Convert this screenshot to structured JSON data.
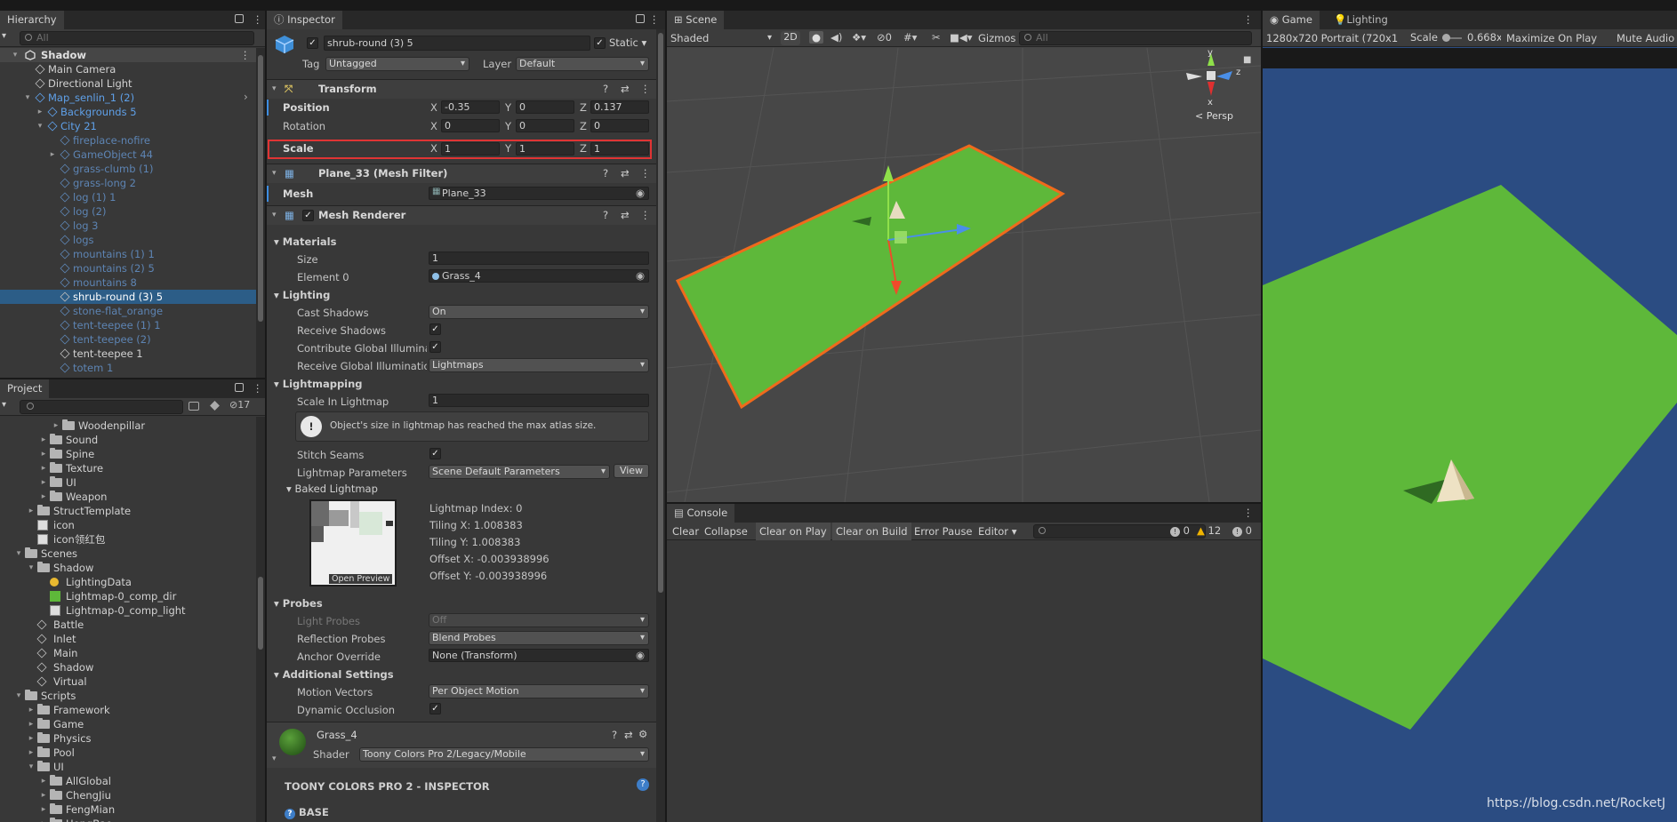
{
  "hierarchy": {
    "tab": "Hierarchy",
    "search_placeholder": "All",
    "scene": "Shadow",
    "items": [
      {
        "label": "Main Camera",
        "indent": 2,
        "style": "normal"
      },
      {
        "label": "Directional Light",
        "indent": 2,
        "style": "normal"
      },
      {
        "label": "Map_senlin_1 (2)",
        "indent": 2,
        "style": "blue",
        "arrow": "▾"
      },
      {
        "label": "Backgrounds 5",
        "indent": 3,
        "style": "blue",
        "arrow": "▸"
      },
      {
        "label": "City 21",
        "indent": 3,
        "style": "blue",
        "arrow": "▾"
      },
      {
        "label": "fireplace-nofire",
        "indent": 4,
        "style": "dim"
      },
      {
        "label": "GameObject 44",
        "indent": 4,
        "style": "dim",
        "arrow": "▸"
      },
      {
        "label": "grass-clumb (1)",
        "indent": 4,
        "style": "dim"
      },
      {
        "label": "grass-long 2",
        "indent": 4,
        "style": "dim"
      },
      {
        "label": "log (1) 1",
        "indent": 4,
        "style": "dim"
      },
      {
        "label": "log (2)",
        "indent": 4,
        "style": "dim"
      },
      {
        "label": "log 3",
        "indent": 4,
        "style": "dim"
      },
      {
        "label": "logs",
        "indent": 4,
        "style": "dim"
      },
      {
        "label": "mountains (1) 1",
        "indent": 4,
        "style": "dim"
      },
      {
        "label": "mountains (2) 5",
        "indent": 4,
        "style": "dim"
      },
      {
        "label": "mountains 8",
        "indent": 4,
        "style": "dim"
      },
      {
        "label": "shrub-round (3) 5",
        "indent": 4,
        "style": "selected"
      },
      {
        "label": "stone-flat_orange",
        "indent": 4,
        "style": "dim"
      },
      {
        "label": "tent-teepee (1) 1",
        "indent": 4,
        "style": "dim"
      },
      {
        "label": "tent-teepee (2)",
        "indent": 4,
        "style": "dim"
      },
      {
        "label": "tent-teepee 1",
        "indent": 4,
        "style": "white"
      },
      {
        "label": "totem 1",
        "indent": 4,
        "style": "dim"
      }
    ]
  },
  "project": {
    "tab": "Project",
    "hidden_count": "17",
    "items": [
      {
        "label": "Woodenpillar",
        "indent": 3,
        "type": "folder",
        "arrow": "▸"
      },
      {
        "label": "Sound",
        "indent": 2,
        "type": "folder",
        "arrow": "▸"
      },
      {
        "label": "Spine",
        "indent": 2,
        "type": "folder",
        "arrow": "▸"
      },
      {
        "label": "Texture",
        "indent": 2,
        "type": "folder",
        "arrow": "▸"
      },
      {
        "label": "UI",
        "indent": 2,
        "type": "folder",
        "arrow": "▸"
      },
      {
        "label": "Weapon",
        "indent": 2,
        "type": "folder",
        "arrow": "▸"
      },
      {
        "label": "StructTemplate",
        "indent": 1,
        "type": "folder",
        "arrow": "▸"
      },
      {
        "label": "icon",
        "indent": 1,
        "type": "image"
      },
      {
        "label": "icon领红包",
        "indent": 1,
        "type": "image"
      },
      {
        "label": "Scenes",
        "indent": 0,
        "type": "folder",
        "arrow": "▾"
      },
      {
        "label": "Shadow",
        "indent": 1,
        "type": "folder",
        "arrow": "▾"
      },
      {
        "label": "LightingData",
        "indent": 2,
        "type": "lighting"
      },
      {
        "label": "Lightmap-0_comp_dir",
        "indent": 2,
        "type": "lightmap"
      },
      {
        "label": "Lightmap-0_comp_light",
        "indent": 2,
        "type": "image"
      },
      {
        "label": "Battle",
        "indent": 1,
        "type": "scene"
      },
      {
        "label": "Inlet",
        "indent": 1,
        "type": "scene"
      },
      {
        "label": "Main",
        "indent": 1,
        "type": "scene"
      },
      {
        "label": "Shadow",
        "indent": 1,
        "type": "scene"
      },
      {
        "label": "Virtual",
        "indent": 1,
        "type": "scene"
      },
      {
        "label": "Scripts",
        "indent": 0,
        "type": "folder",
        "arrow": "▾"
      },
      {
        "label": "Framework",
        "indent": 1,
        "type": "folder",
        "arrow": "▸"
      },
      {
        "label": "Game",
        "indent": 1,
        "type": "folder",
        "arrow": "▸"
      },
      {
        "label": "Physics",
        "indent": 1,
        "type": "folder",
        "arrow": "▸"
      },
      {
        "label": "Pool",
        "indent": 1,
        "type": "folder",
        "arrow": "▸"
      },
      {
        "label": "UI",
        "indent": 1,
        "type": "folder",
        "arrow": "▾"
      },
      {
        "label": "AllGlobal",
        "indent": 2,
        "type": "folder",
        "arrow": "▸"
      },
      {
        "label": "ChengJiu",
        "indent": 2,
        "type": "folder",
        "arrow": "▸"
      },
      {
        "label": "FengMian",
        "indent": 2,
        "type": "folder",
        "arrow": "▸"
      },
      {
        "label": "HongBao",
        "indent": 2,
        "type": "folder",
        "arrow": "▸"
      }
    ]
  },
  "inspector": {
    "tab": "Inspector",
    "object_name": "shrub-round (3) 5",
    "static_label": "Static",
    "tag_label": "Tag",
    "tag_value": "Untagged",
    "layer_label": "Layer",
    "layer_value": "Default",
    "transform": {
      "title": "Transform",
      "position_label": "Position",
      "pos_x": "-0.35",
      "pos_y": "0",
      "pos_z": "0.137",
      "rotation_label": "Rotation",
      "rot_x": "0",
      "rot_y": "0",
      "rot_z": "0",
      "scale_label": "Scale",
      "scale_x": "1",
      "scale_y": "1",
      "scale_z": "1"
    },
    "mesh_filter": {
      "title": "Plane_33 (Mesh Filter)",
      "mesh_label": "Mesh",
      "mesh_value": "Plane_33"
    },
    "mesh_renderer": {
      "title": "Mesh Renderer",
      "materials": "Materials",
      "size_label": "Size",
      "size_value": "1",
      "element0_label": "Element 0",
      "element0_value": "Grass_4",
      "lighting": "Lighting",
      "cast_shadows_label": "Cast Shadows",
      "cast_shadows_value": "On",
      "receive_shadows_label": "Receive Shadows",
      "contribute_gi_label": "Contribute Global Illuminat",
      "receive_gi_label": "Receive Global Illuminatio",
      "receive_gi_value": "Lightmaps",
      "lightmapping": "Lightmapping",
      "scale_lightmap_label": "Scale In Lightmap",
      "scale_lightmap_value": "1",
      "warning": "Object's size in lightmap has reached the max atlas size.",
      "stitch_seams_label": "Stitch Seams",
      "lightmap_params_label": "Lightmap Parameters",
      "lightmap_params_value": "Scene Default Parameters",
      "view_button": "View",
      "baked_lightmap": "Baked Lightmap",
      "open_preview": "Open Preview",
      "lightmap_index": "Lightmap Index: 0",
      "tiling_x": "Tiling X: 1.008383",
      "tiling_y": "Tiling Y: 1.008383",
      "offset_x": "Offset X: -0.003938996",
      "offset_y": "Offset Y: -0.003938996",
      "probes": "Probes",
      "light_probes_label": "Light Probes",
      "light_probes_value": "Off",
      "reflection_probes_label": "Reflection Probes",
      "reflection_probes_value": "Blend Probes",
      "anchor_label": "Anchor Override",
      "anchor_value": "None (Transform)",
      "additional": "Additional Settings",
      "motion_vectors_label": "Motion Vectors",
      "motion_vectors_value": "Per Object Motion",
      "dynamic_occlusion_label": "Dynamic Occlusion"
    },
    "material": {
      "name": "Grass_4",
      "shader_label": "Shader",
      "shader_value": "Toony Colors Pro 2/Legacy/Mobile"
    },
    "toony_header": "TOONY COLORS PRO 2 - INSPECTOR",
    "base_label": "BASE"
  },
  "scene": {
    "tab": "Scene",
    "shading": "Shaded",
    "mode_2d": "2D",
    "hidden_count": "0",
    "gizmos": "Gizmos",
    "search_placeholder": "All",
    "persp": "< Persp",
    "axis_y": "y",
    "axis_x": "x",
    "axis_z": "z"
  },
  "console": {
    "tab": "Console",
    "buttons": [
      "Clear",
      "Collapse",
      "Clear on Play",
      "Clear on Build",
      "Error Pause",
      "Editor"
    ],
    "log_count": "0",
    "warn_count": "12",
    "error_count": "0"
  },
  "game": {
    "tab_game": "Game",
    "tab_lighting": "Lighting",
    "resolution": "1280x720 Portrait (720x1",
    "scale_label": "Scale",
    "scale_value": "0.668x",
    "maximize": "Maximize On Play",
    "mute": "Mute Audio",
    "watermark": "https://blog.csdn.net/RocketJ"
  },
  "colors": {
    "selected_row": "#2c5d87",
    "scale_highlight": "#e03434",
    "game_bg": "#2b4c82",
    "ground_green": "#5eb83a",
    "scene_selection_outline": "#f06a1c"
  }
}
